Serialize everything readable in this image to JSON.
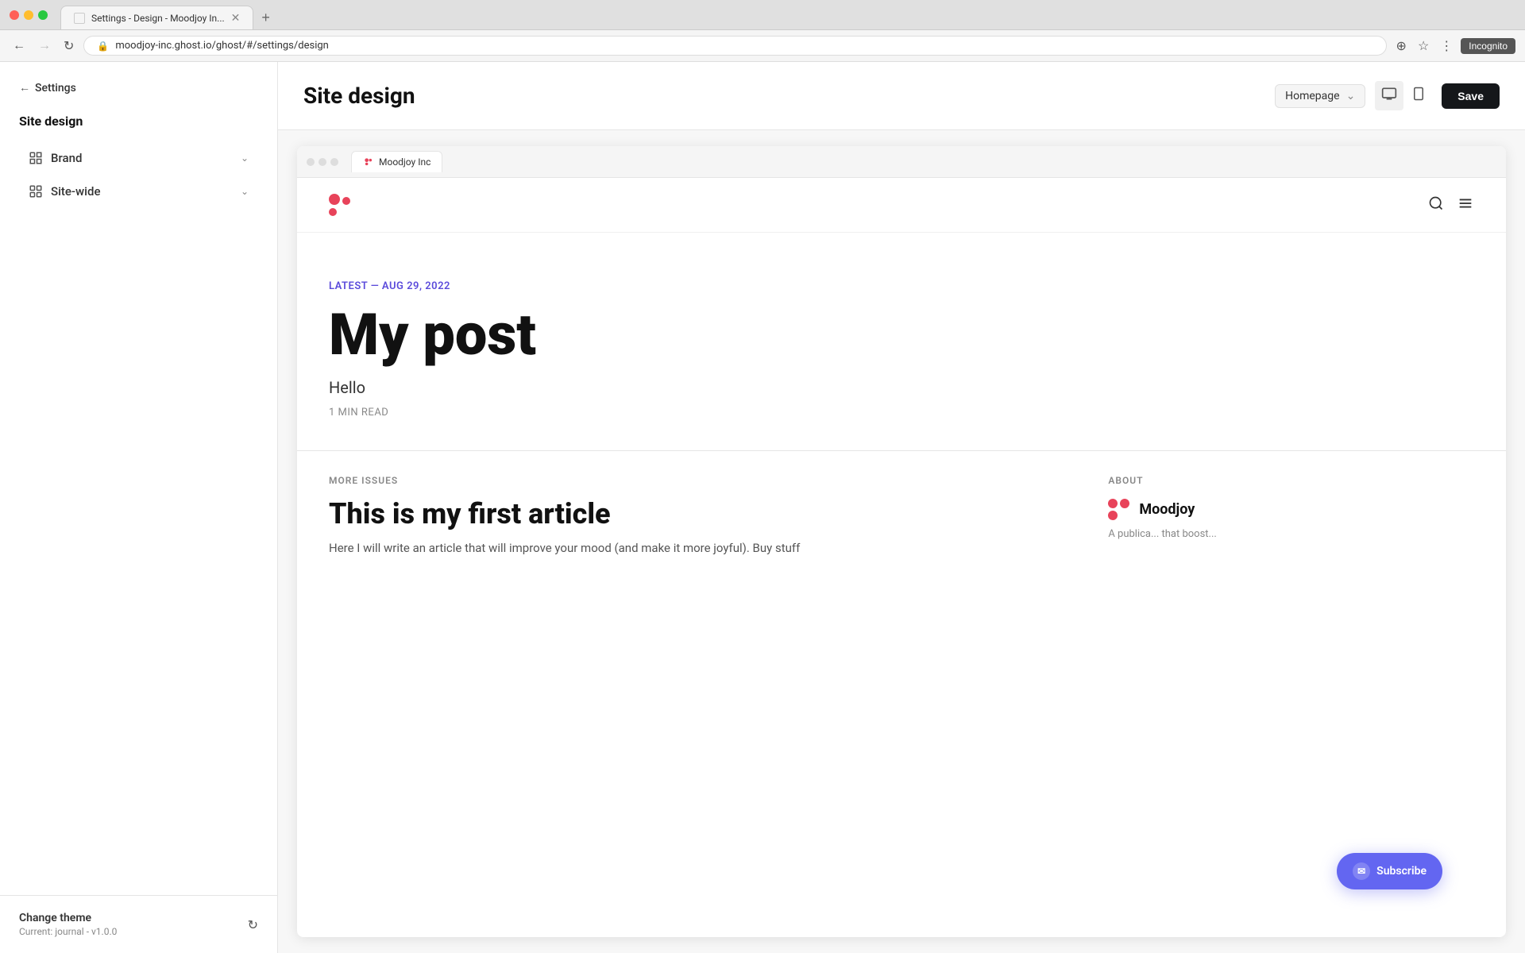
{
  "browser": {
    "tab_title": "Settings - Design - Moodjoy In...",
    "url": "moodjoy-inc.ghost.io/ghost/#/settings/design",
    "incognito_label": "Incognito"
  },
  "header": {
    "back_label": "Settings",
    "title": "Site design",
    "view_selector": "Homepage",
    "save_label": "Save"
  },
  "sidebar": {
    "section_title": "Site design",
    "items": [
      {
        "label": "Brand",
        "icon": "edit-icon"
      },
      {
        "label": "Site-wide",
        "icon": "grid-icon"
      }
    ],
    "footer": {
      "change_theme_label": "Change theme",
      "current_theme": "Current: journal - v1.0.0"
    }
  },
  "preview": {
    "tab_label": "Moodjoy Inc",
    "site_hero": {
      "tag": "LATEST — AUG 29, 2022",
      "title": "My post",
      "subtitle": "Hello",
      "meta": "1 MIN READ"
    },
    "more_issues_label": "MORE ISSUES",
    "about_label": "ABOUT",
    "article": {
      "title": "This is my first article",
      "excerpt": "Here I will write an article that will improve your mood (and make it more joyful). Buy stuff"
    },
    "about": {
      "title": "Moodjoy",
      "desc": "A publica... that boost..."
    },
    "subscribe_label": "Subscribe"
  }
}
